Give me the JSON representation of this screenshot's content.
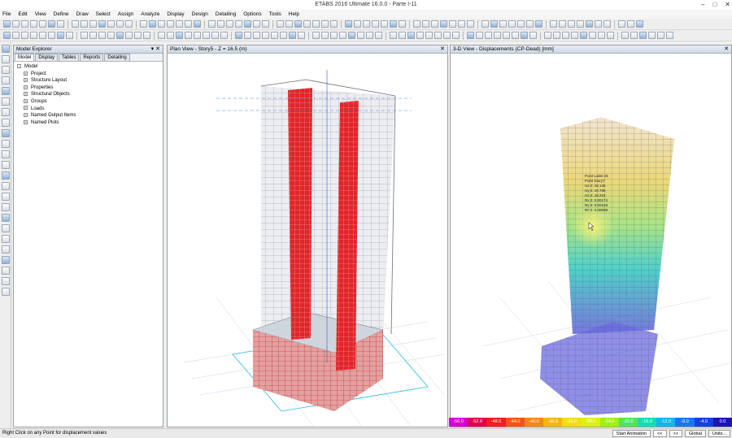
{
  "window": {
    "title": "ETABS 2016 Ultimate 16.0.0 - Parte I-11"
  },
  "menu": [
    "File",
    "Edit",
    "View",
    "Define",
    "Draw",
    "Select",
    "Assign",
    "Analyze",
    "Display",
    "Design",
    "Detailing",
    "Options",
    "Tools",
    "Help"
  ],
  "explorer": {
    "title": "Model Explorer",
    "tabs": [
      "Model",
      "Display",
      "Tables",
      "Reports",
      "Detailing"
    ],
    "root": "Model",
    "items": [
      "Project",
      "Structure Layout",
      "Properties",
      "Structural Objects",
      "Groups",
      "Loads",
      "Named Output Items",
      "Named Plots"
    ]
  },
  "plan_view": {
    "title": "Plan View - Story5 - Z = 16.5 (m)"
  },
  "view_3d": {
    "title": "3-D View  - Displacements (CP-Dead)  [mm]",
    "tooltip": [
      "Point Label 26",
      "Point Story7",
      "Ux 2: 18.145",
      "Uy 2: 10.786",
      "Uz 2: 16.224",
      "Rx 2: 0.00174",
      "Ry 2: 0.00418",
      "Rz 2: 0.00009"
    ]
  },
  "legend": {
    "values": [
      "-56.0",
      "-52.0",
      "-48.0",
      "-44.0",
      "-40.0",
      "-36.0",
      "-32.0",
      "-28.0",
      "-24.0",
      "-20.0",
      "-16.0",
      "-12.0",
      "-8.0",
      "-4.0",
      "0.0"
    ],
    "colors": [
      "#d400d4",
      "#e0004a",
      "#f01e1e",
      "#f55414",
      "#f58814",
      "#f5b414",
      "#f5dc14",
      "#dcf014",
      "#a0f014",
      "#50e650",
      "#14dcb4",
      "#14b4f0",
      "#1478f0",
      "#1440dc",
      "#1e14b4"
    ]
  },
  "status": {
    "message": "Right Click on any Point for displacement values",
    "animation_button": "Start Animation",
    "prev_button": "<<",
    "next_button": ">>",
    "coord_system": "Global",
    "units_button": "Units..."
  }
}
